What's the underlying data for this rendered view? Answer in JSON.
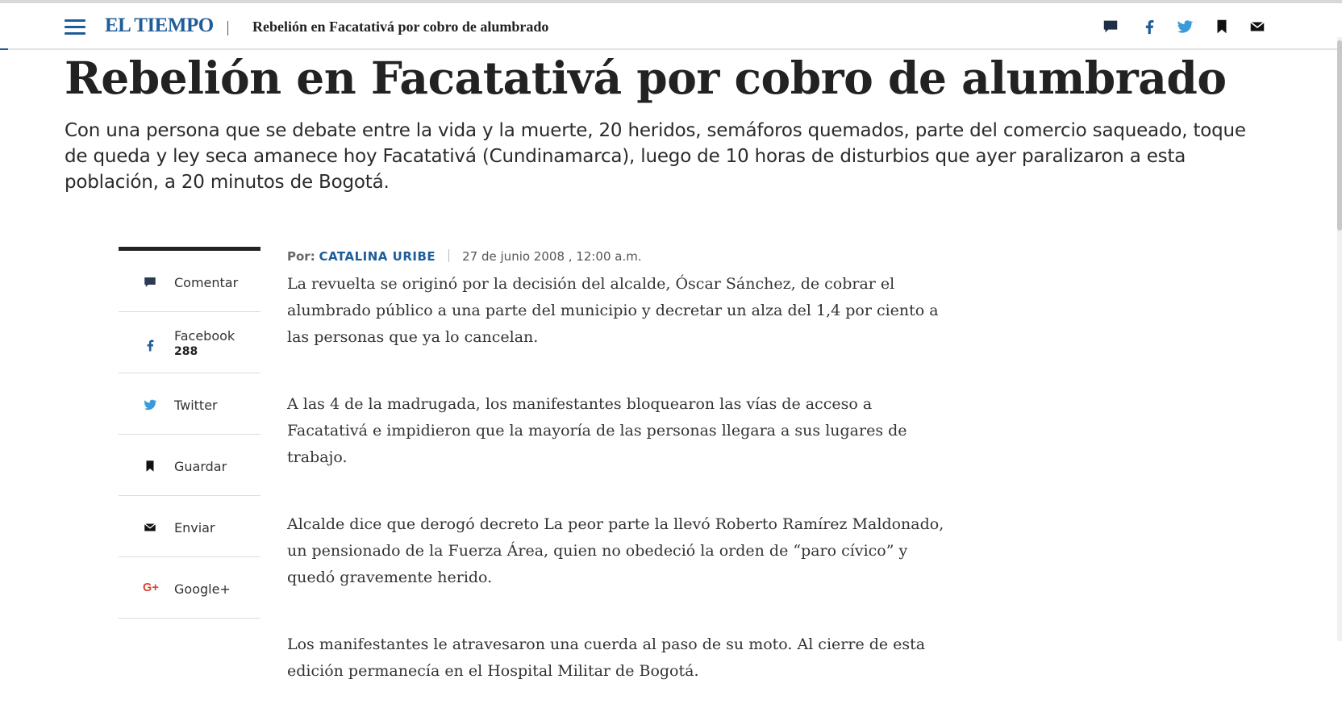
{
  "header": {
    "logo": "EL TIEMPO",
    "title": "Rebelión en Facatativá por cobro de alumbrado",
    "icons": [
      "comment-icon",
      "facebook-icon",
      "twitter-icon",
      "bookmark-icon",
      "mail-icon"
    ],
    "brand_color": "#1f5d99"
  },
  "article": {
    "headline": "Rebelión en Facatativá por cobro de alumbrado",
    "lead": "Con una persona que se debate entre la vida y la muerte, 20 heridos, semáforos quemados, parte del comercio saqueado, toque de queda y ley seca amanece hoy Facatativá (Cundinamarca), luego de 10 horas de disturbios que ayer paralizaron a esta población, a 20 minutos de Bogotá.",
    "byline_prefix": "Por:",
    "author": "CATALINA URIBE",
    "date": "27 de junio 2008 , 12:00 a.m.",
    "paragraphs": [
      "La revuelta se originó por la decisión del alcalde, Óscar Sánchez, de cobrar el alumbrado público a una parte del municipio y decretar un alza del 1,4 por ciento a las personas que ya lo cancelan.",
      "A las 4 de la madrugada, los manifestantes bloquearon las vías de acceso a Facatativá e impidieron que la mayoría de las personas llegara a sus lugares de trabajo.",
      "Alcalde dice que derogó decreto La peor parte la llevó Roberto Ramírez Maldonado, un pensionado de la Fuerza Área, quien no obedeció la orden de “paro cívico” y quedó gravemente herido.",
      "Los manifestantes le atravesaron una cuerda al paso de su moto. Al cierre de esta edición permanecía en el Hospital Militar de Bogotá."
    ]
  },
  "share": {
    "items": [
      {
        "label": "Comentar",
        "icon": "comment-icon"
      },
      {
        "label": "Facebook",
        "icon": "facebook-icon",
        "count": "288"
      },
      {
        "label": "Twitter",
        "icon": "twitter-icon"
      },
      {
        "label": "Guardar",
        "icon": "bookmark-icon"
      },
      {
        "label": "Enviar",
        "icon": "mail-icon"
      },
      {
        "label": "Google+",
        "icon": "google-plus-icon"
      }
    ]
  }
}
